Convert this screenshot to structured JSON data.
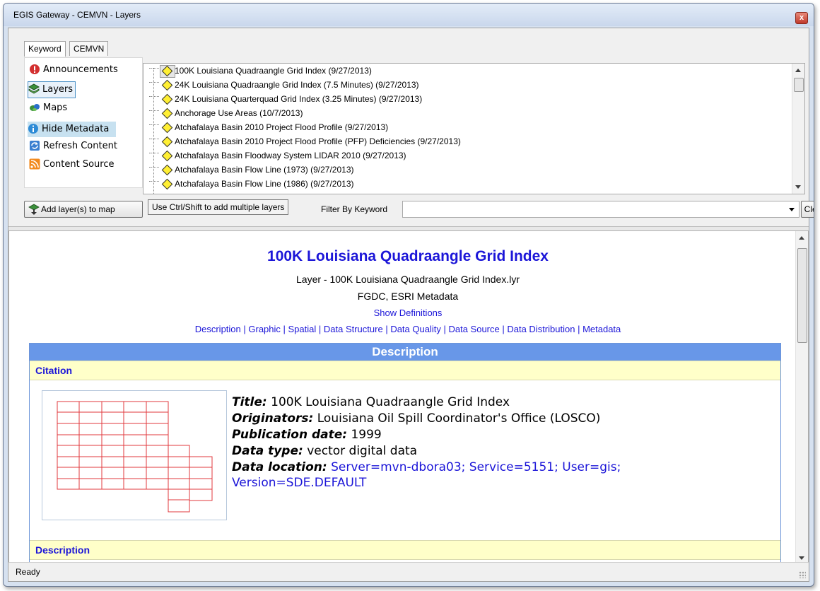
{
  "window": {
    "title": "EGIS Gateway - CEMVN - Layers",
    "close_glyph": "x"
  },
  "tabs": [
    {
      "label": "Keyword",
      "active": true
    },
    {
      "label": "CEMVN",
      "active": false
    }
  ],
  "nav": {
    "items": [
      {
        "label": "Announcements",
        "icon": "alert-icon",
        "color": "#d32f2f"
      },
      {
        "label": "Layers",
        "icon": "layers-icon",
        "selected": true
      },
      {
        "label": "Maps",
        "icon": "maps-icon"
      },
      {
        "label": "Hide Metadata",
        "icon": "info-icon",
        "highlighted": true
      },
      {
        "label": "Refresh Content",
        "icon": "refresh-icon"
      },
      {
        "label": "Content Source",
        "icon": "rss-icon",
        "color": "#f28a1e"
      }
    ]
  },
  "layers": [
    {
      "label": "100K Louisiana Quadraangle Grid Index (9/27/2013)",
      "selected": true
    },
    {
      "label": "24K Louisiana Quadraangle Grid Index (7.5 Minutes) (9/27/2013)"
    },
    {
      "label": "24K Louisiana Quarterquad Grid Index (3.25 Minutes) (9/27/2013)"
    },
    {
      "label": "Anchorage Use Areas (10/7/2013)"
    },
    {
      "label": "Atchafalaya Basin 2010 Project Flood Profile (9/27/2013)"
    },
    {
      "label": "Atchafalaya Basin 2010 Project Flood Profile (PFP) Deficiencies (9/27/2013)"
    },
    {
      "label": "Atchafalaya Basin Floodway System LIDAR 2010 (9/27/2013)"
    },
    {
      "label": "Atchafalaya Basin Flow Line (1973) (9/27/2013)"
    },
    {
      "label": "Atchafalaya Basin Flow Line (1986) (9/27/2013)"
    }
  ],
  "toolbar": {
    "add_label": "Add layer(s) to map",
    "hint_label": "Use Ctrl/Shift to add multiple layers",
    "filter_label": "Filter By Keyword",
    "filter_value": "",
    "clear_label": "Clear"
  },
  "metadata": {
    "title": "100K Louisiana Quadraangle Grid Index",
    "layer_line": "Layer - 100K Louisiana Quadraangle Grid Index.lyr",
    "format_line": "FGDC, ESRI Metadata",
    "show_definitions": "Show Definitions",
    "sections": [
      "Description",
      "Graphic",
      "Spatial",
      "Data Structure",
      "Data Quality",
      "Data Source",
      "Data Distribution",
      "Metadata"
    ],
    "section_separator": " | ",
    "description_header": "Description",
    "citation_header": "Citation",
    "description_sub_header": "Description",
    "citation": {
      "title_label": "Title:",
      "title_value": "100K Louisiana Quadraangle Grid Index",
      "originators_label": "Originators:",
      "originators_value": "Louisiana Oil Spill Coordinator's Office (LOSCO)",
      "pubdate_label": "Publication date:",
      "pubdate_value": "1999",
      "datatype_label": "Data type:",
      "datatype_value": "vector digital data",
      "location_label": "Data location:",
      "location_value_1": "Server=mvn-dbora03; Service=5151; User=gis;",
      "location_value_2": "Version=SDE.DEFAULT"
    }
  },
  "status": {
    "text": "Ready"
  },
  "colors": {
    "link": "#1c16d8",
    "header_bg": "#6897e8",
    "subheader_bg": "#ffffc9",
    "grid_red": "#e0393e"
  }
}
